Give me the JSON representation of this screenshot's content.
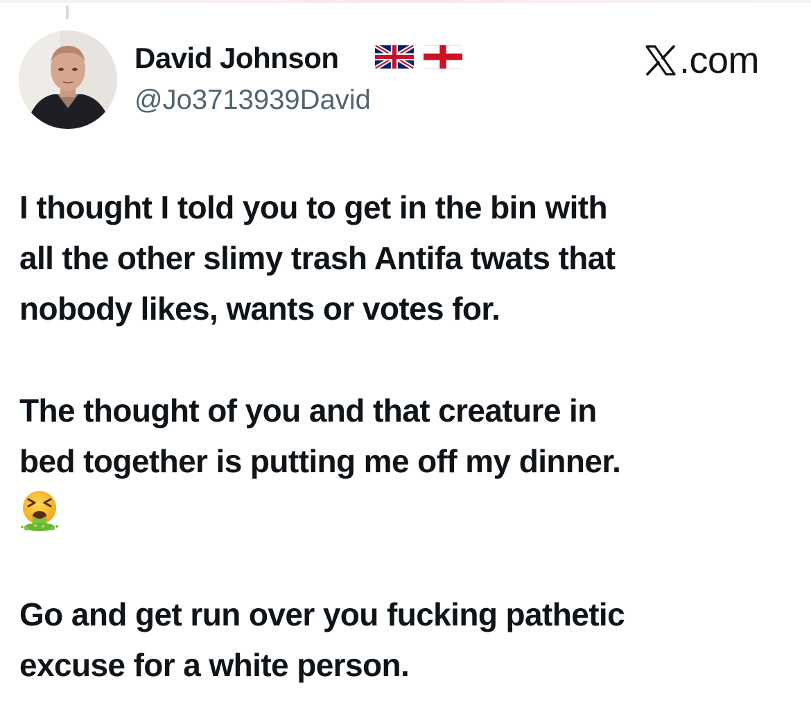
{
  "tweet": {
    "author": {
      "display_name": "David Johnson",
      "handle": "@Jo3713939David",
      "flags": [
        "union-jack-flag",
        "england-flag"
      ]
    },
    "brand": {
      "domain": "X.com",
      "domain_suffix": ".com"
    },
    "body": {
      "paragraph_1": [
        "I thought I told you to get in the bin with",
        "all the other slimy trash Antifa twats that",
        "nobody likes, wants or votes for."
      ],
      "paragraph_2": [
        "The thought of you and that creature in",
        "bed together is putting me off my dinner."
      ],
      "emoji": "vomiting-face-emoji",
      "paragraph_3": [
        "Go and get run over you fucking pathetic",
        "excuse for a white person."
      ]
    }
  },
  "colors": {
    "text": "#0f1419",
    "handle": "#536471",
    "background": "#ffffff"
  }
}
